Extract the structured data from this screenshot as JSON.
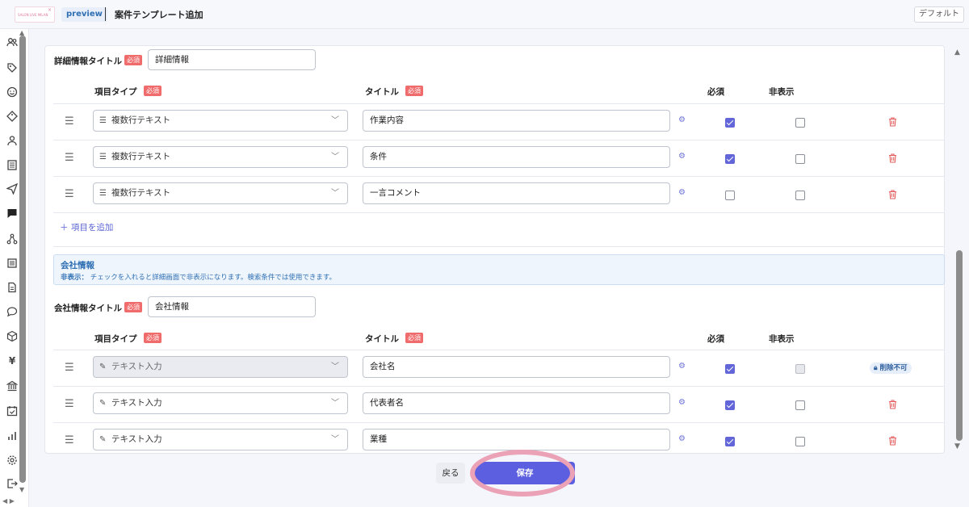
{
  "header": {
    "logo_text": "SALON LIVE MILAN",
    "preview_label": "preview",
    "page_title": "案件テンプレート追加",
    "mode_select": "デフォルト"
  },
  "sidebar": {
    "icons": [
      "users-icon",
      "tag-icon",
      "smile-icon",
      "ticket-icon",
      "person-icon",
      "building-icon",
      "send-icon",
      "chat-icon",
      "network-icon",
      "list-icon",
      "document-icon",
      "comment-icon",
      "box-icon",
      "yen-icon",
      "bank-icon",
      "calendar-check-icon",
      "chart-icon",
      "settings-icon",
      "logout-icon"
    ],
    "yen_glyph": "¥"
  },
  "section1": {
    "title_label": "詳細情報タイトル",
    "required_badge": "必須",
    "title_value": "詳細情報",
    "col_type": "項目タイプ",
    "col_title": "タイトル",
    "col_required": "必須",
    "col_hidden": "非表示",
    "rows": [
      {
        "type": "複数行テキスト",
        "title": "作業内容",
        "required": true,
        "hidden": false
      },
      {
        "type": "複数行テキスト",
        "title": "条件",
        "required": true,
        "hidden": false
      },
      {
        "type": "複数行テキスト",
        "title": "一言コメント",
        "required": false,
        "hidden": false
      }
    ],
    "add_item": "項目を追加"
  },
  "info": {
    "heading": "会社情報",
    "note_label": "非表示：",
    "note_text": "チェックを入れると詳細画面で非表示になります。検索条件では使用できます。"
  },
  "section2": {
    "title_label": "会社情報タイトル",
    "required_badge": "必須",
    "title_value": "会社情報",
    "col_type": "項目タイプ",
    "col_title": "タイトル",
    "col_required": "必須",
    "col_hidden": "非表示",
    "rows": [
      {
        "type": "テキスト入力",
        "title": "会社名",
        "required": true,
        "hidden": false,
        "locked": true
      },
      {
        "type": "テキスト入力",
        "title": "代表者名",
        "required": true,
        "hidden": false,
        "locked": false
      },
      {
        "type": "テキスト入力",
        "title": "業種",
        "required": true,
        "hidden": false,
        "locked": false
      }
    ],
    "no_delete": "削除不可"
  },
  "footer": {
    "back": "戻る",
    "save": "保存"
  },
  "colors": {
    "accent": "#5b5fe0",
    "required_badge": "#f06b6b",
    "delete_icon": "#e35d5d",
    "highlight_ring": "#eba2b6"
  }
}
